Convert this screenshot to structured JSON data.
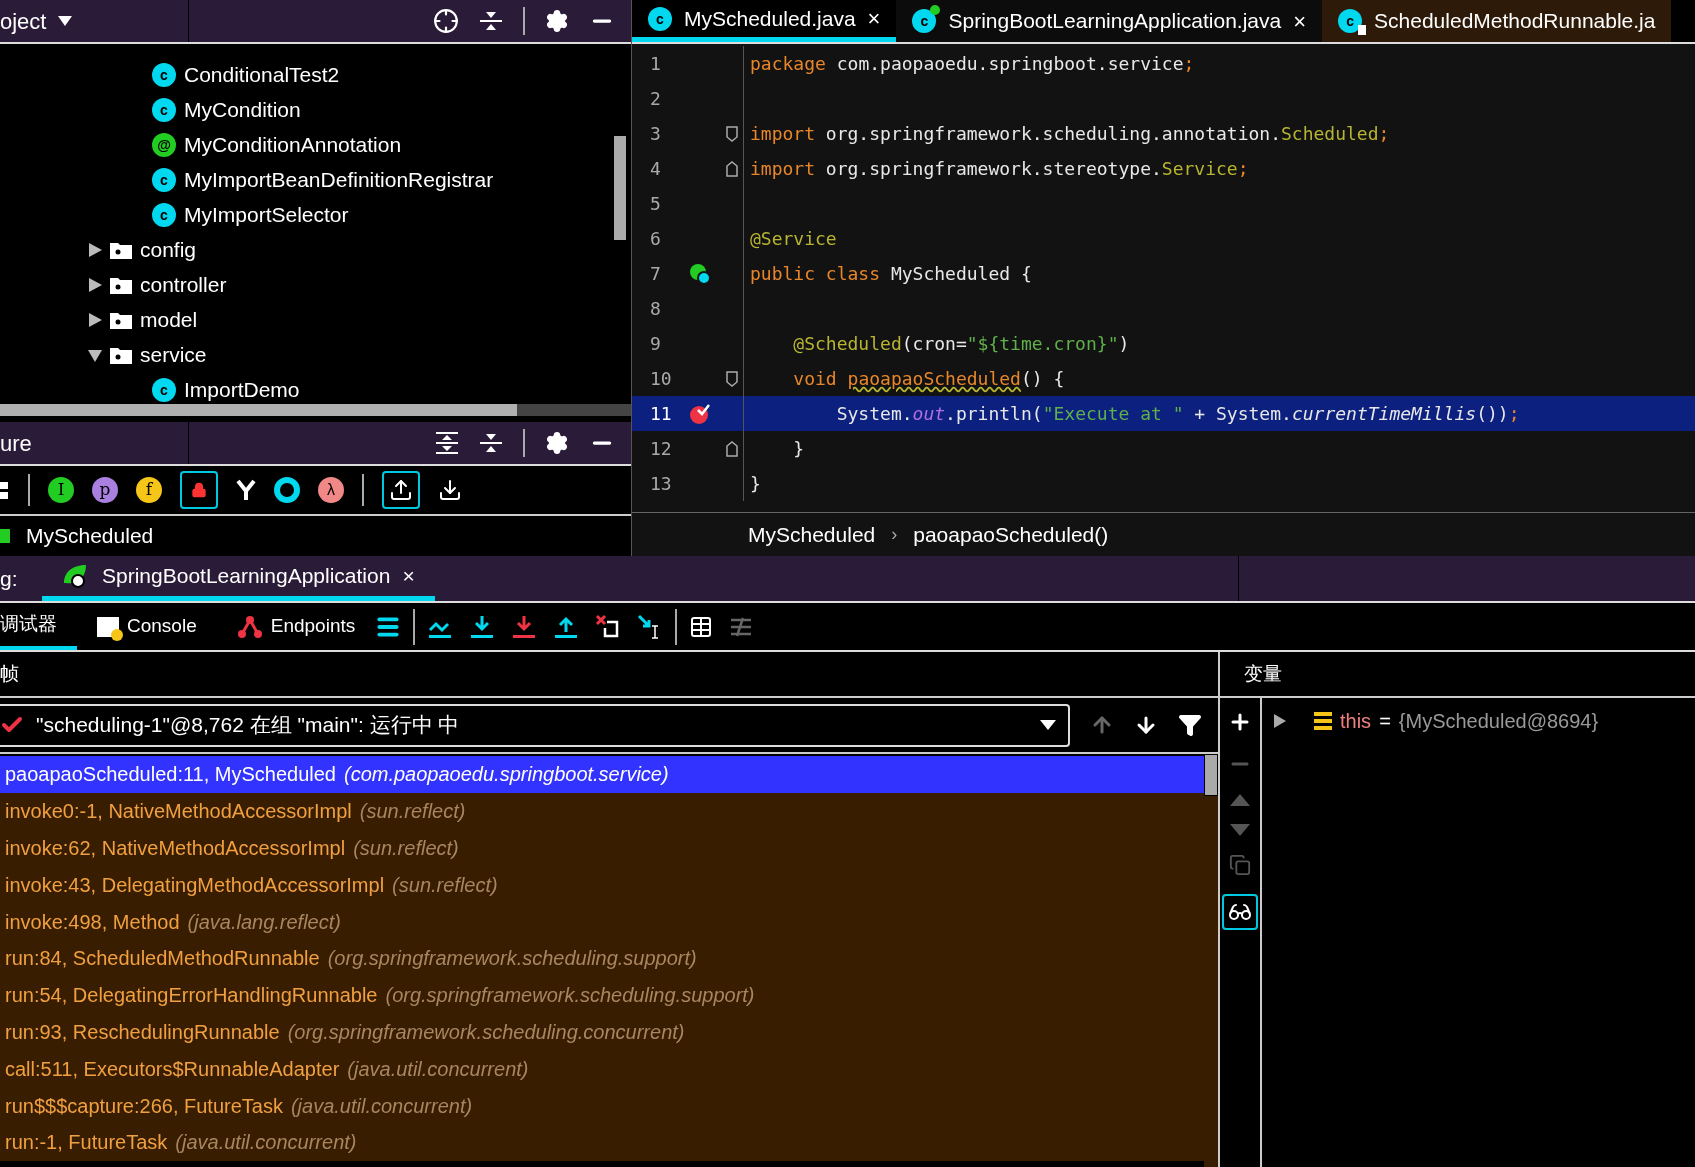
{
  "project_panel": {
    "title": "oject",
    "continued_items": [
      {
        "badge": "c",
        "kind": "class",
        "label": "ConditionalTest2"
      },
      {
        "badge": "c",
        "kind": "class",
        "label": "MyCondition"
      },
      {
        "badge": "@",
        "kind": "annotation",
        "label": "MyConditionAnnotation"
      },
      {
        "badge": "c",
        "kind": "class",
        "label": "MyImportBeanDefinitionRegistrar"
      },
      {
        "badge": "c",
        "kind": "class",
        "label": "MyImportSelector"
      }
    ],
    "folders": [
      {
        "label": "config",
        "expanded": false
      },
      {
        "label": "controller",
        "expanded": false
      },
      {
        "label": "model",
        "expanded": false
      },
      {
        "label": "service",
        "expanded": true,
        "children": [
          {
            "badge": "c",
            "kind": "class",
            "label": "ImportDemo"
          }
        ]
      }
    ]
  },
  "structure_panel": {
    "title": "ure",
    "toolbar_badges": [
      {
        "letter": "I",
        "color": "#22cc22"
      },
      {
        "letter": "p",
        "color": "#a97fe0"
      },
      {
        "letter": "f",
        "color": "#f5c518"
      }
    ],
    "lambda_badge": "λ",
    "root": "MyScheduled"
  },
  "editor": {
    "tabs": [
      {
        "badge": "c",
        "kind": "class",
        "label": "MyScheduled.java",
        "close": "×",
        "selected": true
      },
      {
        "badge": "c",
        "kind": "spring",
        "label": "SpringBootLearningApplication.java",
        "close": "×",
        "selected": false
      },
      {
        "badge": "c",
        "kind": "locked",
        "label": "ScheduledMethodRunnable.ja",
        "selected": false
      }
    ],
    "lines": [
      {
        "n": "1",
        "current": false,
        "tokens": [
          {
            "kind": "kw",
            "text": "package "
          },
          {
            "kind": "plain",
            "text": "com.paopaoedu.springboot.service"
          },
          {
            "kind": "kw",
            "text": ";"
          }
        ]
      },
      {
        "n": "2",
        "current": false
      },
      {
        "n": "3",
        "current": false,
        "fold": {
          "kind": "start"
        },
        "tokens": [
          {
            "kind": "kw",
            "text": "import "
          },
          {
            "kind": "plain",
            "text": "org.springframework.scheduling.annotation."
          },
          {
            "kind": "ann",
            "text": "Scheduled"
          },
          {
            "kind": "kw",
            "text": ";"
          }
        ]
      },
      {
        "n": "4",
        "current": false,
        "fold": {
          "kind": "end"
        },
        "tokens": [
          {
            "kind": "kw",
            "text": "import "
          },
          {
            "kind": "plain",
            "text": "org.springframework.stereotype."
          },
          {
            "kind": "ann",
            "text": "Service"
          },
          {
            "kind": "kw",
            "text": ";"
          }
        ]
      },
      {
        "n": "5",
        "current": false
      },
      {
        "n": "6",
        "current": false,
        "tokens": [
          {
            "kind": "ann",
            "text": "@Service"
          }
        ]
      },
      {
        "n": "7",
        "current": false,
        "gutter": {
          "kind": "bean"
        },
        "tokens": [
          {
            "kind": "kw",
            "text": "public class "
          },
          {
            "kind": "plain",
            "text": "MyScheduled {"
          }
        ]
      },
      {
        "n": "8",
        "current": false
      },
      {
        "n": "9",
        "current": false,
        "tokens": [
          {
            "kind": "ann",
            "text": "    @Scheduled"
          },
          {
            "kind": "plain",
            "text": "(cron="
          },
          {
            "kind": "str",
            "text": "\"${time.cron}\""
          },
          {
            "kind": "plain",
            "text": ")"
          }
        ]
      },
      {
        "n": "10",
        "current": false,
        "fold": {
          "kind": "start"
        },
        "tokens": [
          {
            "kind": "kw",
            "text": "    void "
          },
          {
            "kind": "warn",
            "text": "paoapaoScheduled"
          },
          {
            "kind": "plain",
            "text": "() {"
          }
        ]
      },
      {
        "n": "11",
        "current": true,
        "gutter": {
          "kind": "breakpoint"
        },
        "tokens": [
          {
            "kind": "plain",
            "text": "        System."
          },
          {
            "kind": "field",
            "text": "out"
          },
          {
            "kind": "plain",
            "text": ".println("
          },
          {
            "kind": "str",
            "text": "\"Execute at \""
          },
          {
            "kind": "plain",
            "text": " + System."
          },
          {
            "kind": "static",
            "text": "currentTimeMillis"
          },
          {
            "kind": "plain",
            "text": "())"
          },
          {
            "kind": "kw",
            "text": ";"
          }
        ]
      },
      {
        "n": "12",
        "current": false,
        "fold": {
          "kind": "end"
        },
        "tokens": [
          {
            "kind": "plain",
            "text": "    }"
          }
        ]
      },
      {
        "n": "13",
        "current": false,
        "tokens": [
          {
            "kind": "plain",
            "text": "}"
          }
        ]
      }
    ],
    "breadcrumb": [
      "MyScheduled",
      "›",
      "paoapaoScheduled()"
    ]
  },
  "debug": {
    "prefix": "g:",
    "run_tab": {
      "label": "SpringBootLearningApplication",
      "close": "×"
    },
    "tabs": [
      {
        "label": "调试器",
        "kind": "text",
        "selected": true
      },
      {
        "label": "Console",
        "kind": "console",
        "selected": false
      },
      {
        "label": "Endpoints",
        "kind": "endpoints",
        "selected": false
      }
    ],
    "frames_title": "帧",
    "thread": "\"scheduling-1\"@8,762 在组 \"main\": 运行中 中",
    "frames": [
      {
        "method": "paoapaoScheduled:11, MyScheduled",
        "location": "(com.paopaoedu.springboot.service)",
        "selected": true
      },
      {
        "method": "invoke0:-1, NativeMethodAccessorImpl",
        "location": "(sun.reflect)",
        "selected": false
      },
      {
        "method": "invoke:62, NativeMethodAccessorImpl",
        "location": "(sun.reflect)",
        "selected": false
      },
      {
        "method": "invoke:43, DelegatingMethodAccessorImpl",
        "location": "(sun.reflect)",
        "selected": false
      },
      {
        "method": "invoke:498, Method",
        "location": "(java.lang.reflect)",
        "selected": false
      },
      {
        "method": "run:84, ScheduledMethodRunnable",
        "location": "(org.springframework.scheduling.support)",
        "selected": false
      },
      {
        "method": "run:54, DelegatingErrorHandlingRunnable",
        "location": "(org.springframework.scheduling.support)",
        "selected": false
      },
      {
        "method": "run:93, ReschedulingRunnable",
        "location": "(org.springframework.scheduling.concurrent)",
        "selected": false
      },
      {
        "method": "call:511, Executors$RunnableAdapter",
        "location": "(java.util.concurrent)",
        "selected": false
      },
      {
        "method": "run$$$capture:266, FutureTask",
        "location": "(java.util.concurrent)",
        "selected": false
      },
      {
        "method": "run:-1, FutureTask",
        "location": "(java.util.concurrent)",
        "selected": false
      }
    ],
    "variables_title": "变量",
    "variables": [
      {
        "name": "this",
        "eq": "=",
        "value": "{MyScheduled@8694}"
      }
    ]
  }
}
